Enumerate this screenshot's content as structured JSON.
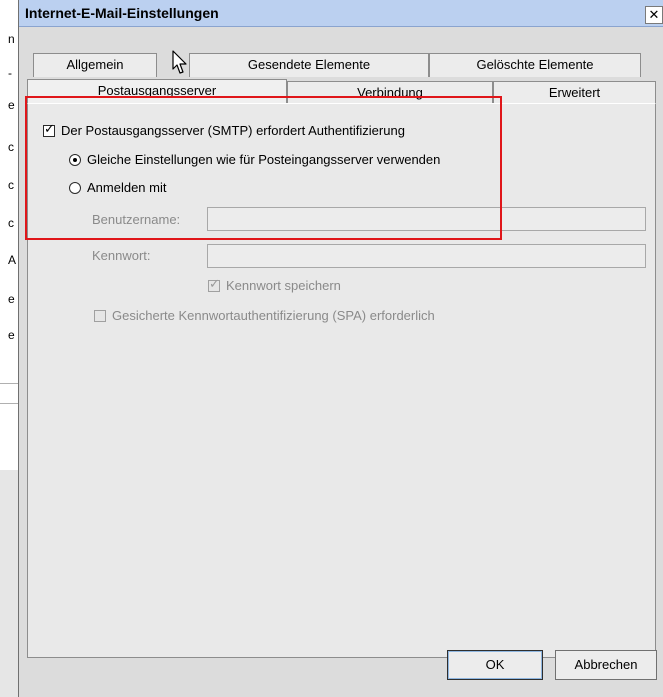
{
  "background": {
    "fragments": [
      "n",
      "-",
      "e",
      "c",
      "c",
      "c",
      "A",
      "e",
      "e"
    ]
  },
  "dialog": {
    "title": "Internet-E-Mail-Einstellungen",
    "close_glyph": "✕"
  },
  "tabs": {
    "row1": [
      "Allgemein",
      "Gesendete Elemente",
      "Gelöschte Elemente"
    ],
    "row2": [
      "Postausgangsserver",
      "Verbindung",
      "Erweitert"
    ],
    "active": "Postausgangsserver"
  },
  "form": {
    "smtp_auth_label": "Der Postausgangsserver (SMTP) erfordert Authentifizierung",
    "smtp_auth_checked": true,
    "same_settings_label": "Gleiche Einstellungen wie für Posteingangsserver verwenden",
    "login_with_label": "Anmelden mit",
    "username_label": "Benutzername:",
    "username_value": "",
    "password_label": "Kennwort:",
    "password_value": "",
    "save_password_label": "Kennwort speichern",
    "spa_label": "Gesicherte Kennwortauthentifizierung (SPA) erforderlich"
  },
  "buttons": {
    "ok": "OK",
    "cancel": "Abbrechen"
  },
  "colors": {
    "highlight": "#e0161a",
    "titlebar": "#bbd0f0"
  },
  "icons": [
    "close-icon",
    "mouse-cursor-icon",
    "checkbox-checked-icon",
    "radio-selected-icon"
  ]
}
